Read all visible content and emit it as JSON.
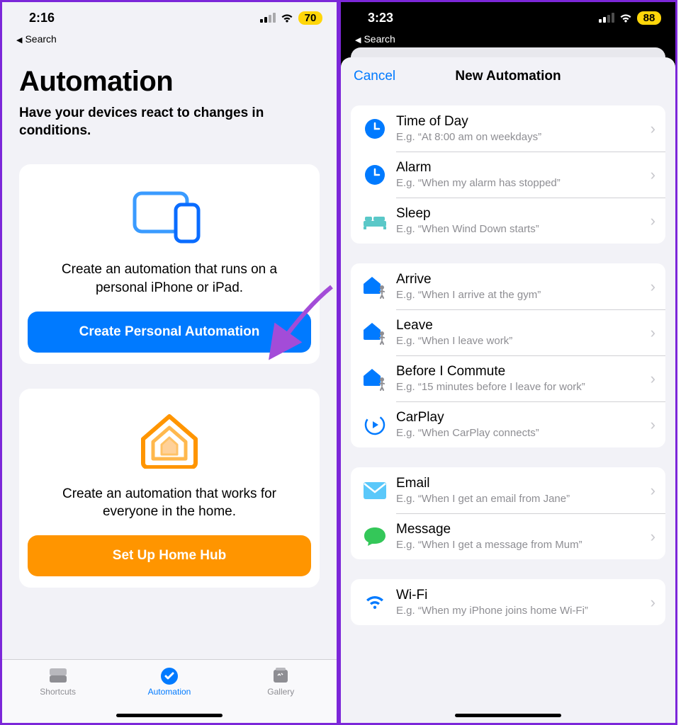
{
  "left": {
    "status": {
      "time": "2:16",
      "battery": "70",
      "back_label": "Search"
    },
    "title": "Automation",
    "subtitle": "Have your devices react to changes in conditions.",
    "personal": {
      "desc": "Create an automation that runs on a personal iPhone or iPad.",
      "button": "Create Personal Automation"
    },
    "home": {
      "desc": "Create an automation that works for everyone in the home.",
      "button": "Set Up Home Hub"
    },
    "tabs": {
      "shortcuts": "Shortcuts",
      "automation": "Automation",
      "gallery": "Gallery"
    }
  },
  "right": {
    "status": {
      "time": "3:23",
      "battery": "88",
      "back_label": "Search"
    },
    "nav": {
      "cancel": "Cancel",
      "title": "New Automation"
    },
    "groups": [
      [
        {
          "icon": "clock",
          "title": "Time of Day",
          "sub": "E.g. “At 8:00 am on weekdays”"
        },
        {
          "icon": "clock",
          "title": "Alarm",
          "sub": "E.g. “When my alarm has stopped”"
        },
        {
          "icon": "bed",
          "title": "Sleep",
          "sub": "E.g. “When Wind Down starts”"
        }
      ],
      [
        {
          "icon": "home-person",
          "title": "Arrive",
          "sub": "E.g. “When I arrive at the gym”"
        },
        {
          "icon": "home-person",
          "title": "Leave",
          "sub": "E.g. “When I leave work”"
        },
        {
          "icon": "home-person",
          "title": "Before I Commute",
          "sub": "E.g. “15 minutes before I leave for work”"
        },
        {
          "icon": "carplay",
          "title": "CarPlay",
          "sub": "E.g. “When CarPlay connects”"
        }
      ],
      [
        {
          "icon": "mail",
          "title": "Email",
          "sub": "E.g. “When I get an email from Jane”"
        },
        {
          "icon": "message",
          "title": "Message",
          "sub": "E.g. “When I get a message from Mum”"
        }
      ],
      [
        {
          "icon": "wifi",
          "title": "Wi-Fi",
          "sub": "E.g. “When my iPhone joins home Wi-Fi”"
        }
      ]
    ]
  }
}
